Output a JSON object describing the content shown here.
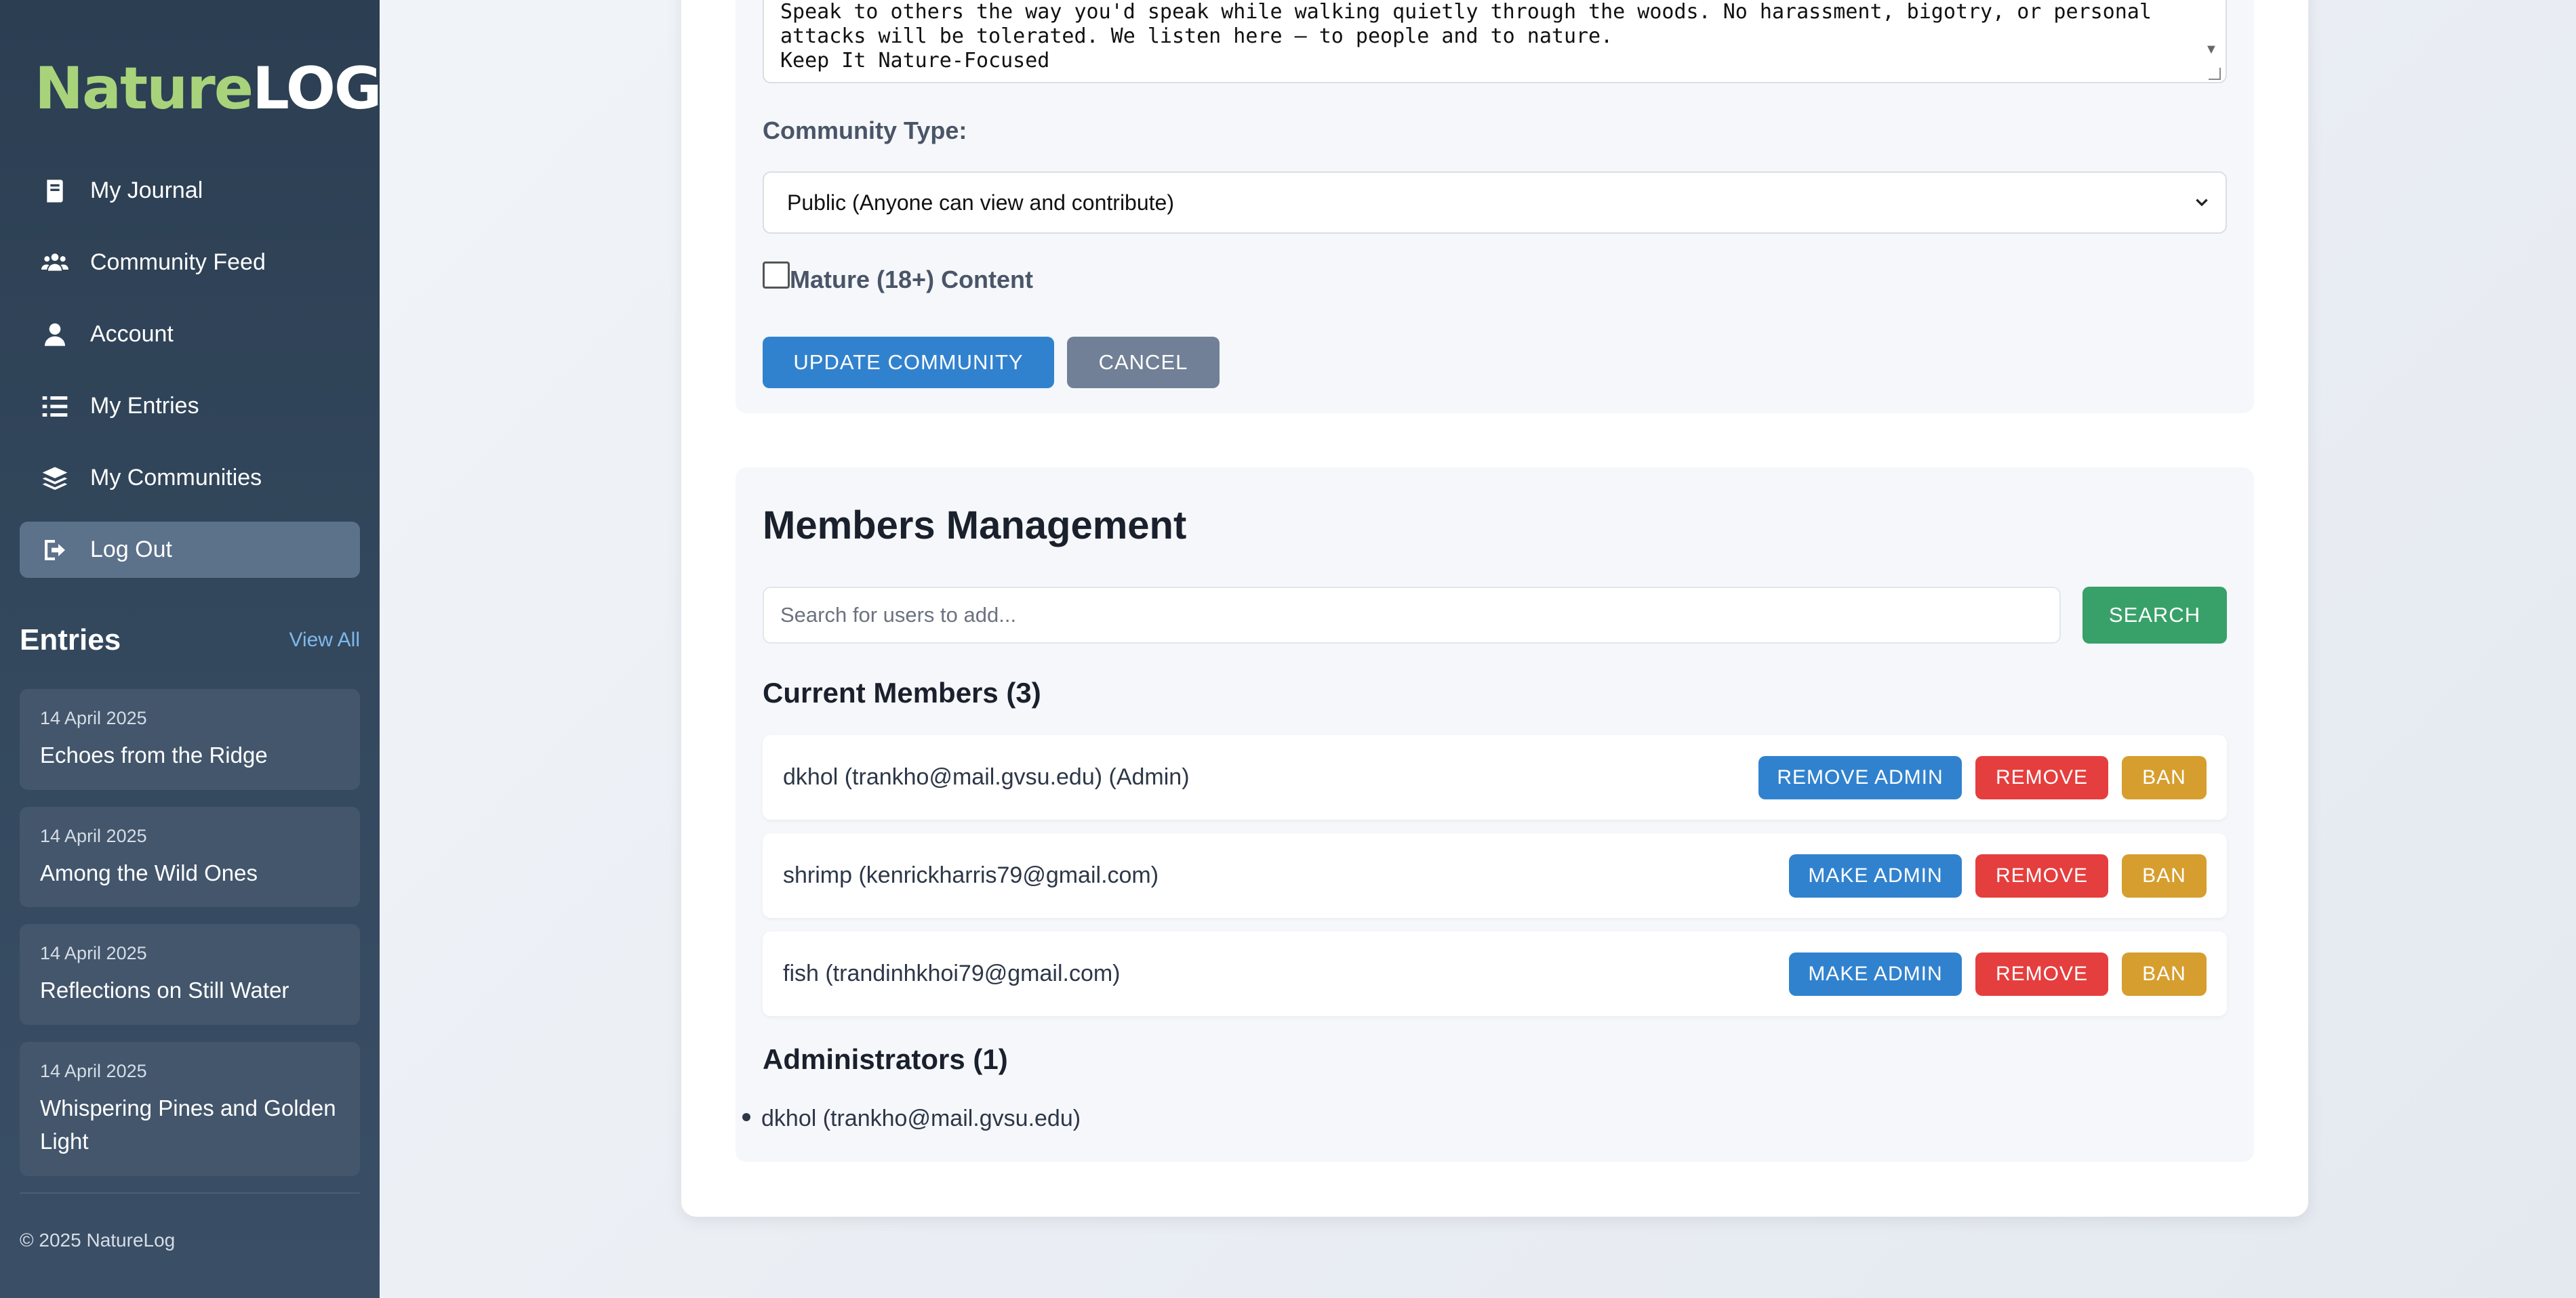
{
  "app": {
    "logo_part1": "Nature",
    "logo_part2": "LOG",
    "footer": "© 2025 NatureLog"
  },
  "sidebar": {
    "nav": [
      {
        "label": "My Journal",
        "icon": "journal-icon"
      },
      {
        "label": "Community Feed",
        "icon": "users-icon"
      },
      {
        "label": "Account",
        "icon": "user-icon"
      },
      {
        "label": "My Entries",
        "icon": "list-icon"
      },
      {
        "label": "My Communities",
        "icon": "layers-icon"
      },
      {
        "label": "Log Out",
        "icon": "logout-icon",
        "active": true
      }
    ],
    "entries_title": "Entries",
    "view_all": "View All",
    "entries": [
      {
        "date": "14 April 2025",
        "title": "Echoes from the Ridge"
      },
      {
        "date": "14 April 2025",
        "title": "Among the Wild Ones"
      },
      {
        "date": "14 April 2025",
        "title": "Reflections on Still Water"
      },
      {
        "date": "14 April 2025",
        "title": "Whispering Pines and Golden Light"
      }
    ]
  },
  "edit_form": {
    "description_lines": [
      "Speak to others the way you'd speak while walking quietly through the woods. No harassment, bigotry, or personal",
      "attacks will be tolerated. We listen here — to people and to nature.",
      "",
      "Keep It Nature-Focused"
    ],
    "community_type_label": "Community Type:",
    "community_type_value": "Public (Anyone can view and contribute)",
    "mature_label": "Mature (18+) Content",
    "mature_checked": false,
    "update_button": "Update Community",
    "cancel_button": "Cancel"
  },
  "members": {
    "title": "Members Management",
    "search_placeholder": "Search for users to add...",
    "search_button": "Search",
    "current_title": "Current Members (3)",
    "list": [
      {
        "name": "dkhol (trankho@mail.gvsu.edu) (Admin)",
        "admin_action": "Remove Admin",
        "remove": "Remove",
        "ban": "Ban"
      },
      {
        "name": "shrimp (kenrickharris79@gmail.com)",
        "admin_action": "Make Admin",
        "remove": "Remove",
        "ban": "Ban"
      },
      {
        "name": "fish (trandinhkhoi79@gmail.com)",
        "admin_action": "Make Admin",
        "remove": "Remove",
        "ban": "Ban"
      }
    ],
    "admins_title": "Administrators (1)",
    "admins": [
      "dkhol (trankho@mail.gvsu.edu)"
    ]
  },
  "colors": {
    "primary": "#3182ce",
    "success": "#38a169",
    "danger": "#e53e3e",
    "warning": "#d69e2e",
    "secondary": "#718096",
    "sidebar": "#34495e",
    "logo_accent": "#a8d37a"
  }
}
